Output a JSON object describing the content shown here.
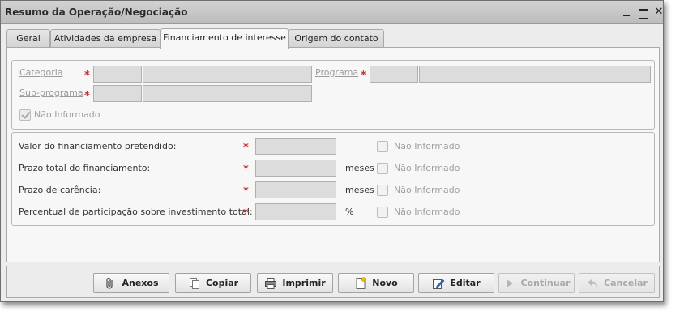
{
  "window": {
    "title": "Resumo da Operação/Negociação",
    "controls": {
      "close_glyph": "✕"
    }
  },
  "tabs": [
    {
      "label": "Geral",
      "active": false
    },
    {
      "label": "Atividades da empresa",
      "active": false
    },
    {
      "label": "Financiamento de interesse",
      "active": true
    },
    {
      "label": "Origem do contato",
      "active": false
    }
  ],
  "program_group": {
    "categoria_label": "Categoria",
    "programa_label": "Programa",
    "subprograma_label": "Sub-programa",
    "required_mark": "*",
    "nao_informado_label": "Não Informado",
    "nao_informado_checked": true
  },
  "financing_group": {
    "rows": [
      {
        "label": "Valor do financiamento pretendido:",
        "unit": "",
        "check_label": "Não Informado"
      },
      {
        "label": "Prazo total do financiamento:",
        "unit": "meses",
        "check_label": "Não Informado"
      },
      {
        "label": "Prazo de carência:",
        "unit": "meses",
        "check_label": "Não Informado"
      },
      {
        "label": "Percentual de participação sobre investimento total:",
        "unit": "%",
        "check_label": "Não Informado"
      }
    ],
    "required_mark": "*"
  },
  "buttons": [
    {
      "label": "Anexos",
      "icon": "paperclip-icon",
      "enabled": true
    },
    {
      "label": "Copiar",
      "icon": "copy-icon",
      "enabled": true
    },
    {
      "label": "Imprimir",
      "icon": "printer-icon",
      "enabled": true
    },
    {
      "label": "Novo",
      "icon": "new-document-icon",
      "enabled": true
    },
    {
      "label": "Editar",
      "icon": "edit-icon",
      "enabled": true
    },
    {
      "label": "Continuar",
      "icon": "play-icon",
      "enabled": false
    },
    {
      "label": "Cancelar",
      "icon": "undo-arrow-icon",
      "enabled": false
    }
  ],
  "colors": {
    "required": "#d12b2b",
    "disabled_text": "#a8a8a8"
  }
}
